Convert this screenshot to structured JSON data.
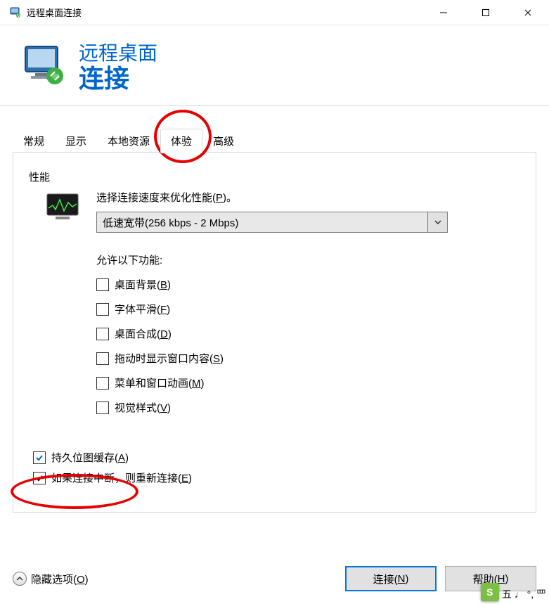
{
  "window": {
    "title": "远程桌面连接"
  },
  "header": {
    "line1": "远程桌面",
    "line2": "连接"
  },
  "tabs": {
    "general": "常规",
    "display": "显示",
    "local": "本地资源",
    "experience": "体验",
    "advanced": "高级"
  },
  "performance": {
    "group_label": "性能",
    "desc_prefix": "选择连接速度来优化性能(",
    "desc_hotkey": "P",
    "desc_suffix": ")。",
    "combo_value": "低速宽带(256 kbps - 2 Mbps)",
    "allow_label": "允许以下功能:",
    "options": [
      {
        "label_prefix": "桌面背景(",
        "hotkey": "B",
        "label_suffix": ")",
        "checked": false
      },
      {
        "label_prefix": "字体平滑(",
        "hotkey": "F",
        "label_suffix": ")",
        "checked": false
      },
      {
        "label_prefix": "桌面合成(",
        "hotkey": "D",
        "label_suffix": ")",
        "checked": false
      },
      {
        "label_prefix": "拖动时显示窗口内容(",
        "hotkey": "S",
        "label_suffix": ")",
        "checked": false
      },
      {
        "label_prefix": "菜单和窗口动画(",
        "hotkey": "M",
        "label_suffix": ")",
        "checked": false
      },
      {
        "label_prefix": "视觉样式(",
        "hotkey": "V",
        "label_suffix": ")",
        "checked": false
      }
    ]
  },
  "outer_checks": {
    "bitmap": {
      "label_prefix": "持久位图缓存(",
      "hotkey": "A",
      "label_suffix": ")",
      "checked": true
    },
    "reconnect": {
      "label_prefix": "如果连接中断，则重新连接(",
      "hotkey": "E",
      "label_suffix": ")",
      "checked": true
    }
  },
  "bottom": {
    "hide": {
      "label_prefix": "隐藏选项(",
      "hotkey": "O",
      "label_suffix": ")"
    },
    "connect": {
      "label_prefix": "连接(",
      "hotkey": "N",
      "label_suffix": ")"
    },
    "help": {
      "label_prefix": "帮助(",
      "hotkey": "H",
      "label_suffix": ")"
    }
  },
  "ime": {
    "badge": "S",
    "text": "五 ♩ °, 罒"
  }
}
